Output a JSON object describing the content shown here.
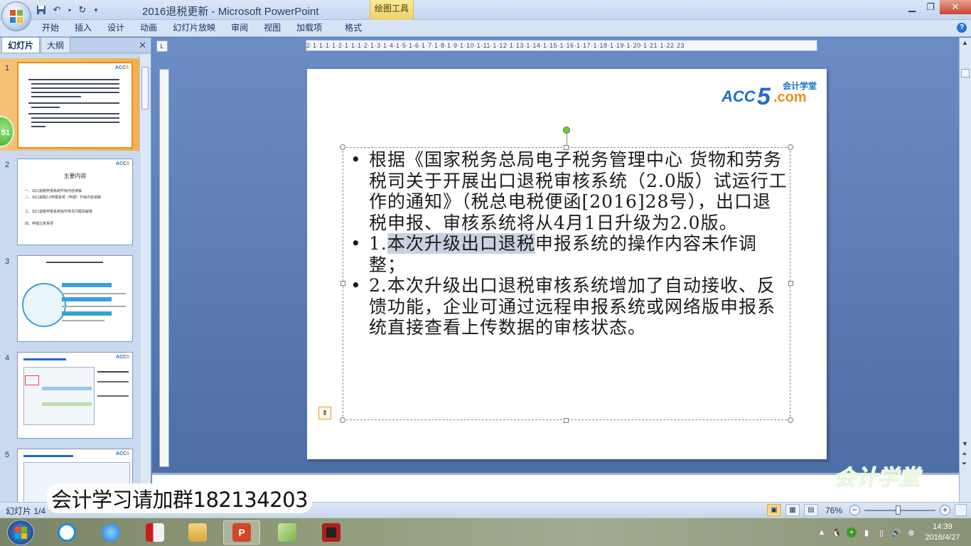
{
  "window": {
    "title": "2016退税更新 - Microsoft PowerPoint",
    "context_tab": "绘图工具",
    "controls": {
      "minimize": "▁",
      "maximize": "❐",
      "close": "✕"
    }
  },
  "qat": {
    "save_icon": "save-icon",
    "undo_icon": "undo-icon",
    "redo_icon": "redo-icon"
  },
  "ribbon": {
    "tabs": [
      "开始",
      "插入",
      "设计",
      "动画",
      "幻灯片放映",
      "审阅",
      "视图",
      "加载项",
      "格式"
    ],
    "help": "?"
  },
  "left_pane": {
    "tabs": [
      "幻灯片",
      "大纲"
    ],
    "close": "✕",
    "badge": "51",
    "slides": [
      {
        "num": "1",
        "selected": true
      },
      {
        "num": "2",
        "title": "主要内容",
        "items": [
          "一、出口退税申报系统升级内容讲解",
          "二、出口退税2.0申报系统（申报）升级内容讲解",
          "三、出口退税申报系统操作常见问题及解答",
          "四、申报注意事项"
        ]
      },
      {
        "num": "3"
      },
      {
        "num": "4"
      },
      {
        "num": "5"
      }
    ],
    "thumb_logo_a": "ACC",
    "thumb_logo_b": "5"
  },
  "ruler": {
    "horizontal": "2·1·1·1·1·2·1·1·1·2·1·3·1·4·1·5·1·6·1·7·1·8·1·9·1·10·1·11·1·12·1·13·1·14·1·15·1·16·1·17·1·18·1·19·1·20·1·21·1·22·23",
    "corner": "L"
  },
  "slide": {
    "logo": {
      "acc": "ACC",
      "five": "5",
      "dotcom": ".com",
      "cn": "会计学堂"
    },
    "bullets": [
      {
        "text": "根据《国家税务总局电子税务管理中心  货物和劳务税司关于开展出口退税审核系统（2.0版）试运行工作的通知》（税总电税便函[2016]28号），出口退税申报、审核系统将从4月1日升级为2.0版。"
      },
      {
        "pre": "1.",
        "highlight": "本次升级出口退税",
        "post": "申报系统的操作内容未作调整；"
      },
      {
        "text": "2.本次升级出口退税审核系统增加了自动接收、反馈功能，企业可通过远程申报系统或网络版申报系统直接查看上传数据的审核状态。"
      }
    ],
    "autofit_icon": "⇟"
  },
  "status": {
    "left": "幻灯片 1/4",
    "zoom": "76%",
    "zoom_out": "−",
    "zoom_in": "+"
  },
  "overlay": {
    "text": "会计学习请加群182134203",
    "watermark": "会计学堂"
  },
  "taskbar": {
    "apps": [
      "windows-icon",
      "cloud-icon",
      "browser-icon",
      "app-red-icon",
      "explorer-icon",
      "powerpoint-icon",
      "notes-icon",
      "camera-icon"
    ],
    "clock_time": "14:39",
    "clock_date": "2016/4/27"
  },
  "colors": {
    "accent": "#1d6dcc",
    "orange": "#f08b16",
    "selection": "#f3b04f"
  }
}
